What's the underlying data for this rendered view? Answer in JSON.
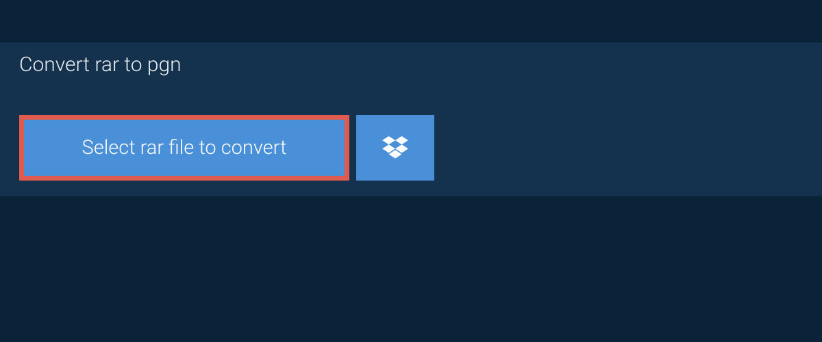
{
  "tab": {
    "title": "Convert rar to pgn"
  },
  "buttons": {
    "select_file_label": "Select rar file to convert"
  },
  "colors": {
    "background": "#0a2338",
    "panel": "#14324d",
    "button": "#4a90d9",
    "highlight_border": "#e05a4d"
  }
}
